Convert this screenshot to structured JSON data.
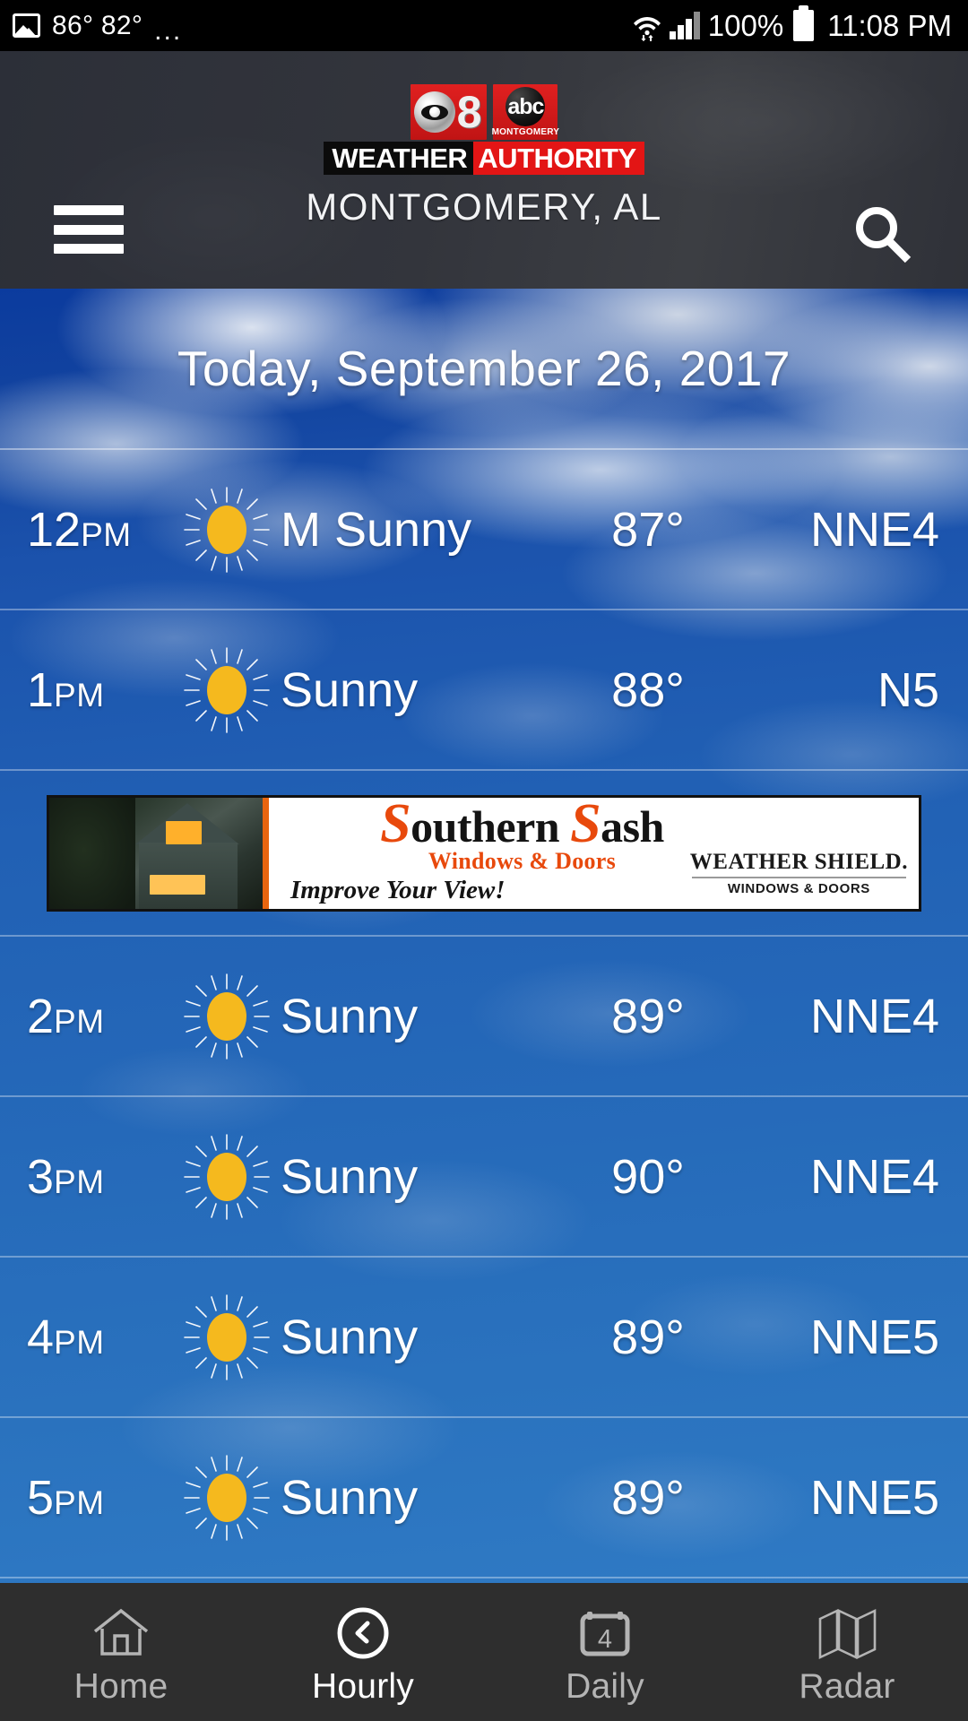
{
  "status_bar": {
    "image_icon": "image-icon",
    "temps": "86° 82°",
    "overflow": "...",
    "wifi_icon": "wifi-icon",
    "signal_icon": "signal-bars-icon",
    "battery_percent": "100%",
    "battery_icon": "battery-full-icon",
    "time": "11:08 PM"
  },
  "header": {
    "menu_icon": "hamburger-menu-icon",
    "search_icon": "search-icon",
    "logo": {
      "cbs_eye_icon": "cbs-eye-icon",
      "channel_number": "8",
      "abc_text": "abc",
      "abc_city": "MONTGOMERY",
      "weather_word": "WEATHER",
      "authority_word": "AUTHORITY"
    },
    "location": "MONTGOMERY, AL"
  },
  "date_header": "Today, September 26, 2017",
  "hourly": [
    {
      "time": "12",
      "ampm": "PM",
      "icon": "sunny-icon",
      "condition": "M Sunny",
      "temp": "87°",
      "wind": "NNE4"
    },
    {
      "time": "1",
      "ampm": "PM",
      "icon": "sunny-icon",
      "condition": "Sunny",
      "temp": "88°",
      "wind": "N5"
    },
    {
      "time": "2",
      "ampm": "PM",
      "icon": "sunny-icon",
      "condition": "Sunny",
      "temp": "89°",
      "wind": "NNE4"
    },
    {
      "time": "3",
      "ampm": "PM",
      "icon": "sunny-icon",
      "condition": "Sunny",
      "temp": "90°",
      "wind": "NNE4"
    },
    {
      "time": "4",
      "ampm": "PM",
      "icon": "sunny-icon",
      "condition": "Sunny",
      "temp": "89°",
      "wind": "NNE5"
    },
    {
      "time": "5",
      "ampm": "PM",
      "icon": "sunny-icon",
      "condition": "Sunny",
      "temp": "89°",
      "wind": "NNE5"
    }
  ],
  "ad": {
    "brand_s1": "S",
    "brand_word1": "outhern",
    "brand_s2": "S",
    "brand_word2": "ash",
    "subtitle": "Windows & Doors",
    "tagline": "Improve Your View!",
    "partner_name": "WEATHER SHIELD.",
    "partner_sub": "WINDOWS & DOORS",
    "photo_icon": "house-photo"
  },
  "nav": [
    {
      "label": "Home",
      "icon": "home-icon",
      "active": false
    },
    {
      "label": "Hourly",
      "icon": "clock-icon",
      "active": true
    },
    {
      "label": "Daily",
      "icon": "calendar-icon",
      "active": false,
      "badge": "4"
    },
    {
      "label": "Radar",
      "icon": "map-icon",
      "active": false
    }
  ],
  "colors": {
    "sky_blue": "#2160b4",
    "header_dark": "#2f3138",
    "nav_dark": "#2e2e2e",
    "sun_yellow": "#f5b91e",
    "brand_red": "#e31515",
    "ad_orange": "#e8490c"
  }
}
